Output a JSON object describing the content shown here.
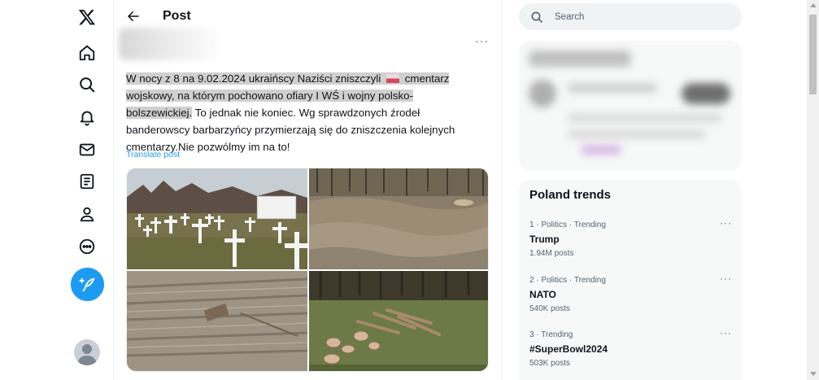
{
  "header": {
    "title": "Post"
  },
  "nav": {
    "items": [
      {
        "icon": "x-logo-icon"
      },
      {
        "icon": "home-icon"
      },
      {
        "icon": "explore-icon"
      },
      {
        "icon": "notifications-icon"
      },
      {
        "icon": "messages-icon"
      },
      {
        "icon": "lists-icon"
      },
      {
        "icon": "profile-icon"
      },
      {
        "icon": "more-icon"
      }
    ],
    "compose_icon": "compose-post-icon"
  },
  "post": {
    "text_part1": "W nocy z 8 na 9.02.2024 ukraińscy Naziści zniszczyli",
    "text_part2": "cmentarz wojskowy, na którym pochowano ofiary I WŚ i wojny polsko-bolszewickiej.",
    "text_part3": " To jednak nie koniec. Wg sprawdzonych źrodeł banderowscy barbarzyńcy przymierzają się do zniszczenia kolejnych cmentarzy.Nie pozwólmy im na to!",
    "translate_label": "Translate post",
    "more_label": "···"
  },
  "search": {
    "placeholder": "Search"
  },
  "trends": {
    "title": "Poland trends",
    "items": [
      {
        "meta": "1 · Politics · Trending",
        "name": "Trump",
        "posts": "1.94M posts"
      },
      {
        "meta": "2 · Politics · Trending",
        "name": "NATO",
        "posts": "540K posts"
      },
      {
        "meta": "3 · Trending",
        "name": "#SuperBowl2024",
        "posts": "503K posts"
      }
    ],
    "more_label": "···"
  },
  "colors": {
    "accent": "#1d9bf0",
    "text": "#0f1419",
    "secondary": "#536471",
    "panel": "#f7f9f9"
  }
}
